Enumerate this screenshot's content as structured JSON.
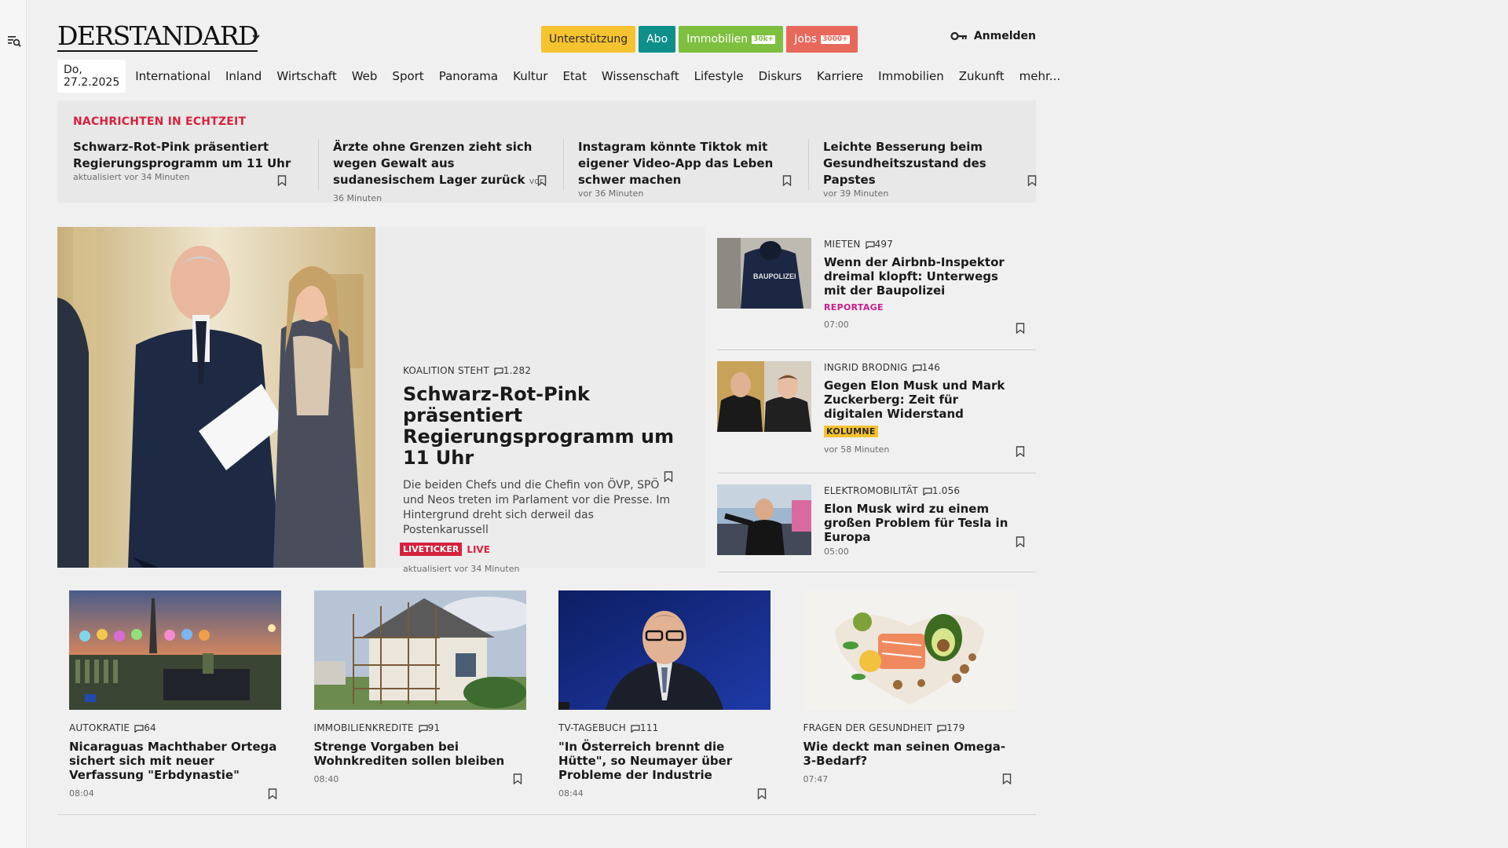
{
  "header": {
    "logo": "DERSTANDARD",
    "pills": {
      "support": "Unterstützung",
      "abo": "Abo",
      "immo": "Immobilien",
      "immo_tag": "30k+",
      "jobs": "Jobs",
      "jobs_tag": "3000+"
    },
    "login": "Anmelden"
  },
  "nav": {
    "date": "Do, 27.2.2025",
    "items": [
      "International",
      "Inland",
      "Wirtschaft",
      "Web",
      "Sport",
      "Panorama",
      "Kultur",
      "Etat",
      "Wissenschaft",
      "Lifestyle",
      "Diskurs",
      "Karriere",
      "Immobilien",
      "Zukunft",
      "mehr..."
    ]
  },
  "ticker": {
    "heading": "NACHRICHTEN IN ECHTZEIT",
    "items": [
      {
        "title": "Schwarz-Rot-Pink präsentiert Regierungsprogramm um 11 Uhr",
        "meta": "aktualisiert vor 34 Minuten"
      },
      {
        "title": "Ärzte ohne Grenzen zieht sich wegen Gewalt aus sudanesischem Lager zurück",
        "meta": "vor 36 Minuten"
      },
      {
        "title": "Instagram könnte Tiktok mit eigener Video-App das Leben schwer machen",
        "meta": "vor 36 Minuten"
      },
      {
        "title": "Leichte Besserung beim Gesundheitszustand des Papstes",
        "meta": "vor 39 Minuten"
      }
    ]
  },
  "lead": {
    "kicker": "KOALITION STEHT",
    "comments": "1.282",
    "title": "Schwarz-Rot-Pink präsentiert Regierungsprogramm um 11 Uhr",
    "teaser": "Die beiden Chefs und die Chefin von ÖVP, SPÖ und Neos treten im Parlament vor die Presse. Im Hintergrund dreht sich derweil das Postenkarussell",
    "live_badge": "LIVETICKER",
    "live_text": "LIVE",
    "meta": "aktualisiert vor 34 Minuten"
  },
  "side": [
    {
      "kicker": "MIETEN",
      "comments": "497",
      "title": "Wenn der Airbnb-Inspektor dreimal klopft: Unterwegs mit der Baupolizei",
      "label": "REPORTAGE",
      "meta": "07:00",
      "thumb_text": "BAUPOLIZEI"
    },
    {
      "kicker": "INGRID BRODNIG",
      "comments": "146",
      "title": "Gegen Elon Musk und Mark Zuckerberg: Zeit für digitalen Widerstand",
      "label": "KOLUMNE",
      "meta": "vor 58 Minuten"
    },
    {
      "kicker": "ELEKTROMOBILITÄT",
      "comments": "1.056",
      "title": "Elon Musk wird zu einem großen Problem für Tesla in Europa",
      "meta": "05:00"
    }
  ],
  "cards": [
    {
      "kicker": "AUTOKRATIE",
      "comments": "64",
      "title": "Nicaraguas Machthaber Ortega sichert sich mit neuer Verfassung \"Erbdynastie\"",
      "meta": "08:04"
    },
    {
      "kicker": "IMMOBILIENKREDITE",
      "comments": "91",
      "title": "Strenge Vorgaben bei Wohnkrediten sollen bleiben",
      "meta": "08:40"
    },
    {
      "kicker": "TV-TAGEBUCH",
      "comments": "111",
      "title": "\"In Österreich brennt die Hütte\", so Neumayer über Probleme der Industrie",
      "meta": "08:44"
    },
    {
      "kicker": "FRAGEN DER GESUNDHEIT",
      "comments": "179",
      "title": "Wie deckt man seinen Omega-3-Bedarf?",
      "meta": "07:47"
    }
  ],
  "colors": {
    "accent_red": "#d6223e",
    "support_yellow": "#f5c230",
    "abo_teal": "#0e8f8a",
    "immo_green": "#7fbf3f",
    "jobs_red": "#e8685c",
    "reportage_magenta": "#c81d8c"
  },
  "icons": {
    "menu": "menu-search-icon",
    "logo_chevron": "chevron-down-icon",
    "login": "key-icon",
    "bookmark": "bookmark-icon",
    "comments": "comment-icon"
  }
}
